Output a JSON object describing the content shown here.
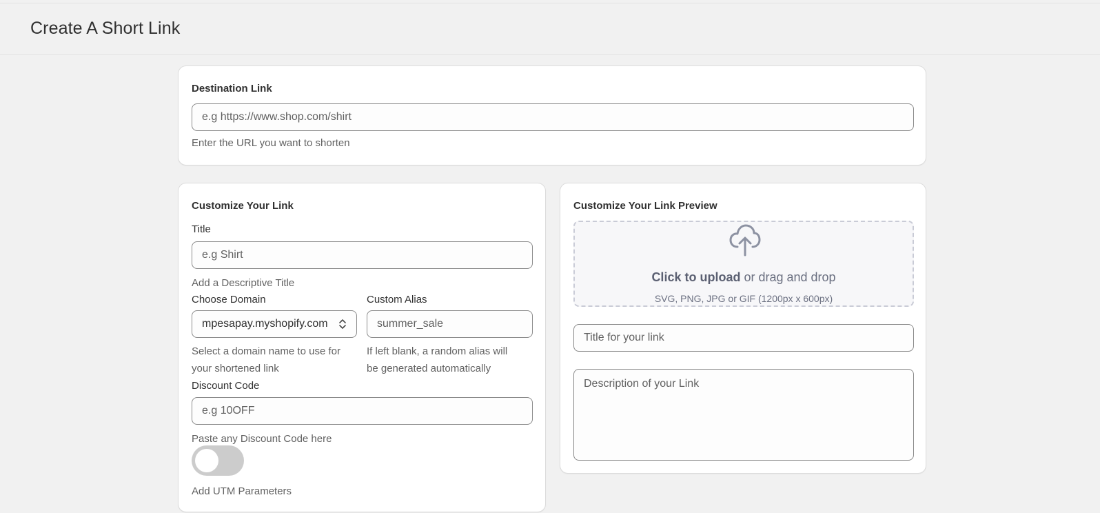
{
  "header": {
    "title": "Create A Short Link"
  },
  "destination": {
    "title": "Destination Link",
    "placeholder": "e.g https://www.shop.com/shirt",
    "help": "Enter the URL you want to shorten"
  },
  "customize": {
    "title": "Customize Your Link",
    "title_label": "Title",
    "title_placeholder": "e.g Shirt",
    "title_help": "Add a Descriptive Title",
    "domain_label": "Choose Domain",
    "domain_value": "mpesapay.myshopify.com",
    "domain_help_1": "Select a domain name to use for",
    "domain_help_2": "your shortened link",
    "alias_label": "Custom Alias",
    "alias_placeholder": "summer_sale",
    "alias_help_1": "If left blank, a random alias will",
    "alias_help_2": "be generated automatically",
    "discount_label": "Discount Code",
    "discount_placeholder": "e.g 10OFF",
    "discount_help": "Paste any Discount Code here",
    "utm_toggle_on": false,
    "utm_label": "Add UTM Parameters"
  },
  "preview": {
    "title": "Customize Your Link Preview",
    "upload_strong": "Click to upload",
    "upload_rest": " or drag and drop",
    "upload_hint": "SVG, PNG, JPG or GIF (1200px x 600px)",
    "link_title_placeholder": "Title for your link",
    "description_placeholder": "Description of your Link"
  },
  "icons": {
    "upload": "cloud-upload-icon",
    "select_chevrons": "chevron-up-down-icon"
  }
}
